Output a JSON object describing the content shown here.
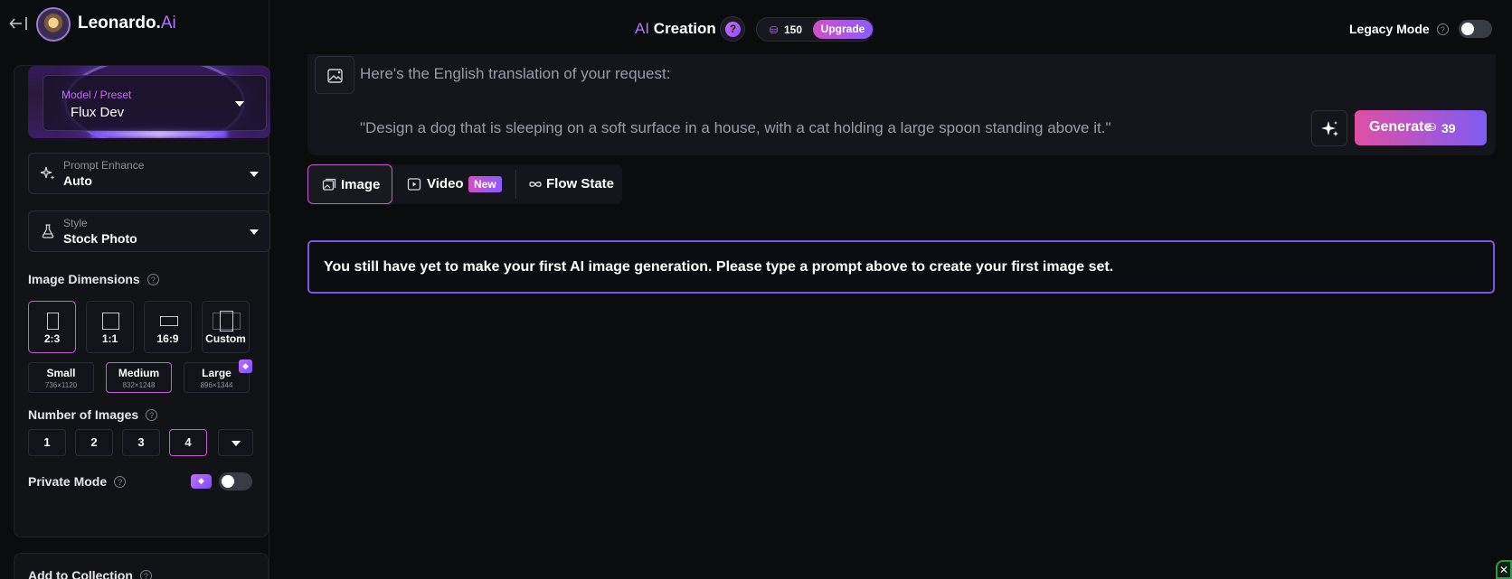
{
  "brand": {
    "name_main": "Leonardo.",
    "name_ai": "Ai"
  },
  "header": {
    "title_ai": "AI",
    "title_rest": " Creation",
    "help": "?",
    "tokens": "150",
    "upgrade_label": "Upgrade",
    "legacy_label": "Legacy Mode",
    "legacy_help": "?"
  },
  "sidebar": {
    "model": {
      "label": "Model / Preset",
      "value": "Flux Dev"
    },
    "prompt_enhance": {
      "label": "Prompt Enhance",
      "value": "Auto"
    },
    "style": {
      "label": "Style",
      "value": "Stock Photo"
    },
    "dimensions": {
      "title": "Image Dimensions",
      "help": "?",
      "ratios": [
        "2:3",
        "1:1",
        "16:9",
        "Custom"
      ],
      "sizes": [
        {
          "label": "Small",
          "dims": "736×1120"
        },
        {
          "label": "Medium",
          "dims": "832×1248"
        },
        {
          "label": "Large",
          "dims": "896×1344"
        }
      ]
    },
    "num_images": {
      "title": "Number of Images",
      "help": "?",
      "options": [
        "1",
        "2",
        "3",
        "4"
      ]
    },
    "private_mode": {
      "title": "Private Mode",
      "help": "?"
    },
    "collection": {
      "title": "Add to Collection"
    }
  },
  "prompt": {
    "line1": "Here's the English translation of your request:",
    "line2": "\"Design a dog that is sleeping on a soft surface in a house, with a cat holding a large spoon standing above it.\"",
    "generate_label": "Generate",
    "generate_cost": "39"
  },
  "tabs": [
    {
      "label": "Image"
    },
    {
      "label": "Video",
      "badge": "New"
    },
    {
      "label": "Flow State"
    }
  ],
  "notice": "You still have yet to make your first AI image generation. Please type a prompt above to create your first image set.",
  "colors": {
    "accent_purple": "#b276ff",
    "accent_pink": "#c85bd8",
    "border_violet": "#7b57e6"
  }
}
